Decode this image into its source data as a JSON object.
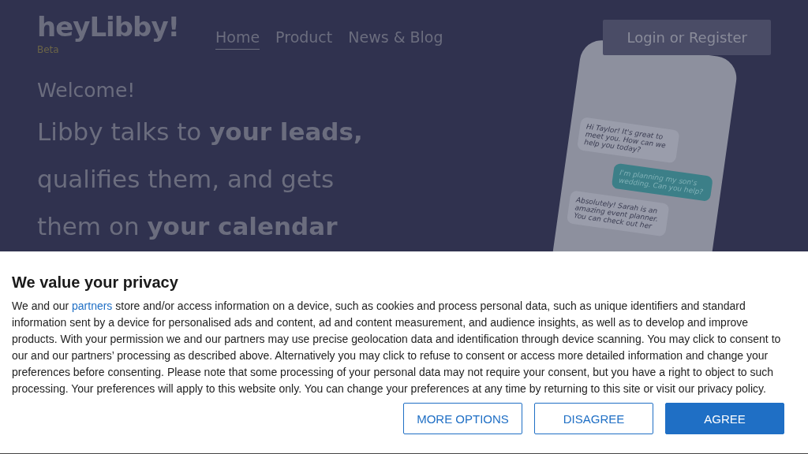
{
  "header": {
    "logo": "heyLibby!",
    "badge": "Beta",
    "nav": [
      {
        "label": "Home",
        "selected": true
      },
      {
        "label": "Product",
        "selected": false
      },
      {
        "label": "News & Blog",
        "selected": false
      }
    ],
    "login_button": "Login or Register"
  },
  "hero": {
    "greeting": "Welcome!",
    "headline": [
      "Libby talks to **your leads,**",
      "qualifies them, and gets",
      "them on **your calendar**"
    ]
  },
  "phone": {
    "messages": [
      {
        "kind": "bot",
        "text": "Hi Taylor! It's great to meet you. How can we help you today?"
      },
      {
        "kind": "user",
        "text": "I'm planning my son's wedding. Can you help?"
      },
      {
        "kind": "bot",
        "text": "Absolutely! Sarah is an amazing event planner. You can check out her"
      }
    ]
  },
  "consent": {
    "title": "We value your privacy",
    "body_before": "We and our ",
    "link": "partners",
    "body_after": " store and/or access information on a device, such as cookies and process personal data, such as unique identifiers and standard information sent by a device for personalised ads and content, ad and content measurement, and audience insights, as well as to develop and improve products. With your permission we and our partners may use precise geolocation data and identification through device scanning. You may click to consent to our and our partners’ processing as described above. Alternatively you may click to refuse to consent or access more detailed information and change your preferences before consenting. Please note that some processing of your personal data may not require your consent, but you have a right to object to such processing. Your preferences will apply to this website only. You can change your preferences at any time by returning to this site or visit our privacy policy.",
    "buttons": [
      {
        "kind": "outline",
        "label": "MORE OPTIONS"
      },
      {
        "kind": "outline",
        "label": "DISAGREE"
      },
      {
        "kind": "primary",
        "label": "AGREE"
      }
    ]
  }
}
